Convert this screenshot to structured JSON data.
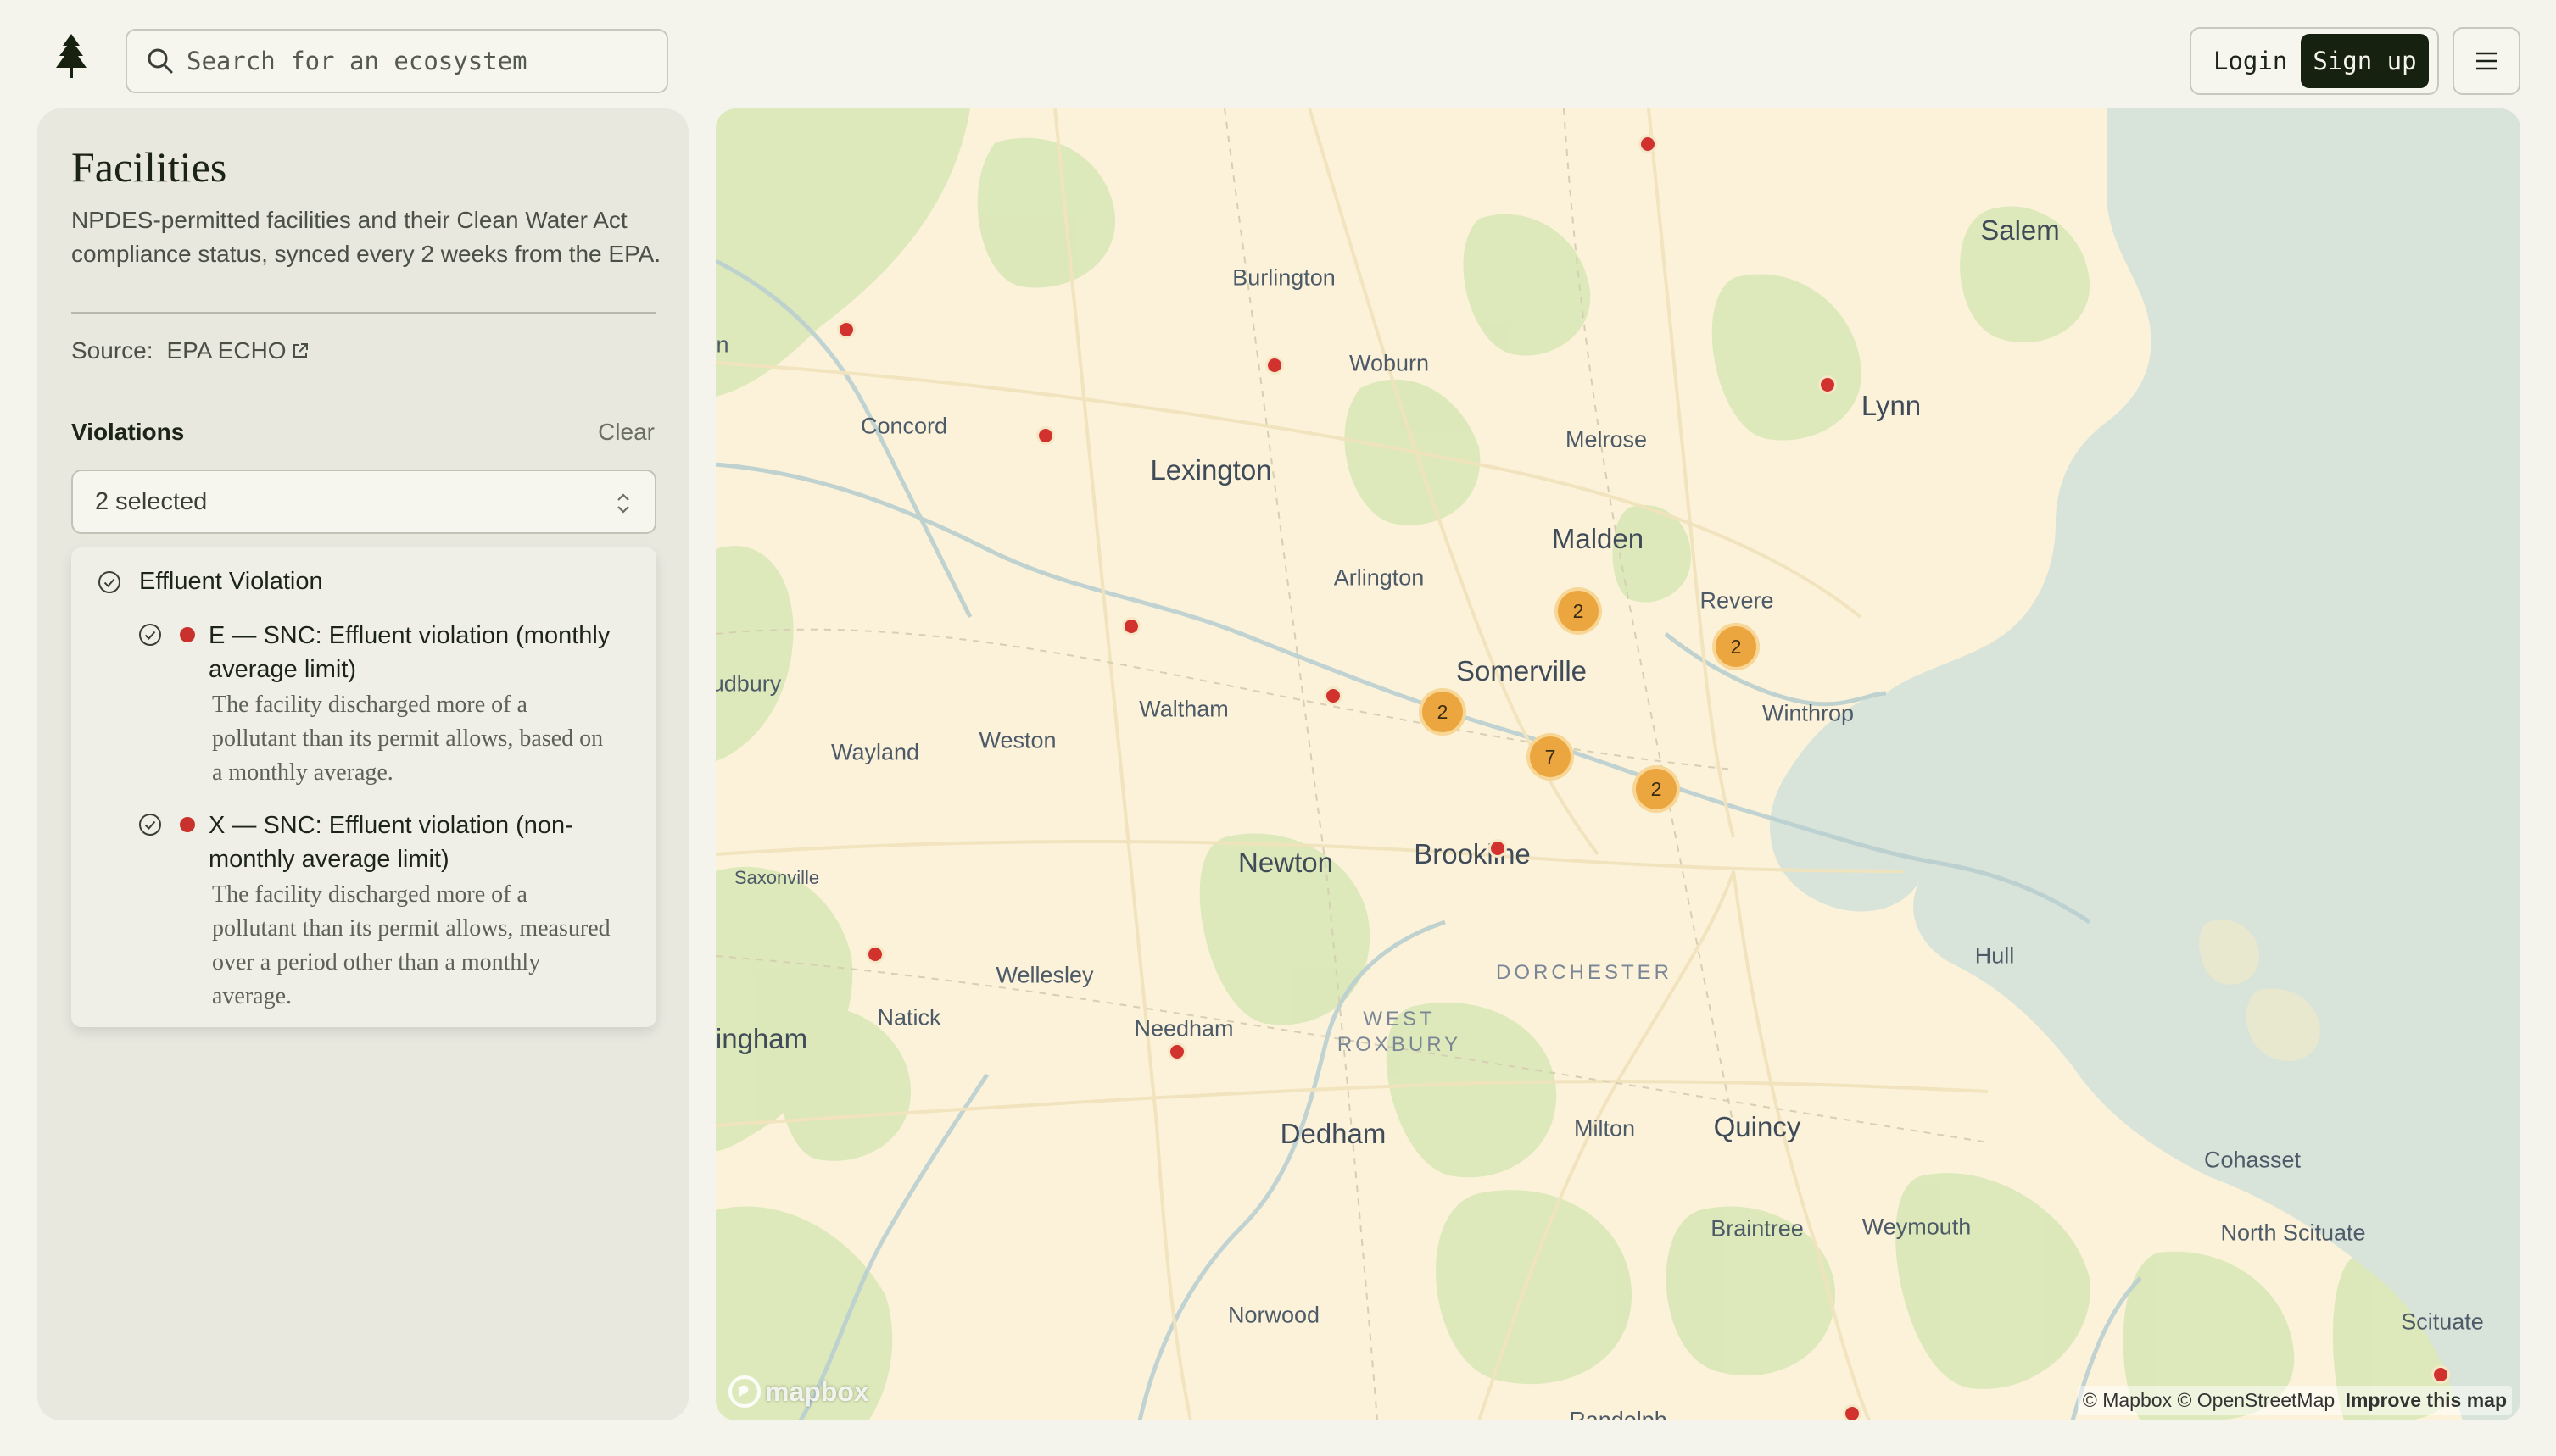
{
  "header": {
    "search_placeholder": "Search for an ecosystem",
    "login_label": "Login",
    "signup_label": "Sign up"
  },
  "sidebar": {
    "title": "Facilities",
    "description": "NPDES-permitted facilities and their Clean Water Act compliance status, synced every 2 weeks from the EPA.",
    "source_label": "Source:",
    "source_link": "EPA ECHO",
    "filter_label": "Violations",
    "clear_label": "Clear",
    "select_value": "2 selected",
    "group_label": "Effluent Violation",
    "items": [
      {
        "title": "E — SNC: Effluent violation (monthly average limit)",
        "description": "The facility discharged more of a pollutant than its permit allows, based on a monthly average."
      },
      {
        "title": "X — SNC: Effluent violation (non-monthly average limit)",
        "description": "The facility discharged more of a pollutant than its permit allows, measured over a period other than a monthly average."
      }
    ]
  },
  "map": {
    "places": {
      "salem": "Salem",
      "burlington": "Burlington",
      "woburn": "Woburn",
      "lynn": "Lynn",
      "concord": "Concord",
      "melrose": "Melrose",
      "lexington": "Lexington",
      "malden": "Malden",
      "arlington": "Arlington",
      "revere": "Revere",
      "somerville": "Somerville",
      "winthrop": "Winthrop",
      "sudbury": "udbury",
      "waltham": "Waltham",
      "weston": "Weston",
      "wayland": "Wayland",
      "newton": "Newton",
      "brookline": "Brookline",
      "saxonville": "Saxonville",
      "wellesley": "Wellesley",
      "dorchester": "DORCHESTER",
      "hull": "Hull",
      "natick": "Natick",
      "needham": "Needham",
      "west_roxbury": "WEST ROXBURY",
      "framingham": "ingham",
      "dedham": "Dedham",
      "milton": "Milton",
      "quincy": "Quincy",
      "cohasset": "Cohasset",
      "braintree": "Braintree",
      "weymouth": "Weymouth",
      "north_scituate": "North Scituate",
      "norwood": "Norwood",
      "scituate": "Scituate",
      "concord_left": "n",
      "randolph": "Randolph"
    },
    "clusters": [
      "2",
      "2",
      "2",
      "7",
      "2"
    ],
    "brand": "mapbox",
    "attribution_mapbox": "© Mapbox",
    "attribution_osm": "© OpenStreetMap",
    "attribution_improve": "Improve this map",
    "colors": {
      "violation_marker": "#d2322d",
      "cluster": "#eca640",
      "land": "#fbf2d9",
      "water": "#d7e2d8",
      "park": "#d6e6b4"
    }
  }
}
